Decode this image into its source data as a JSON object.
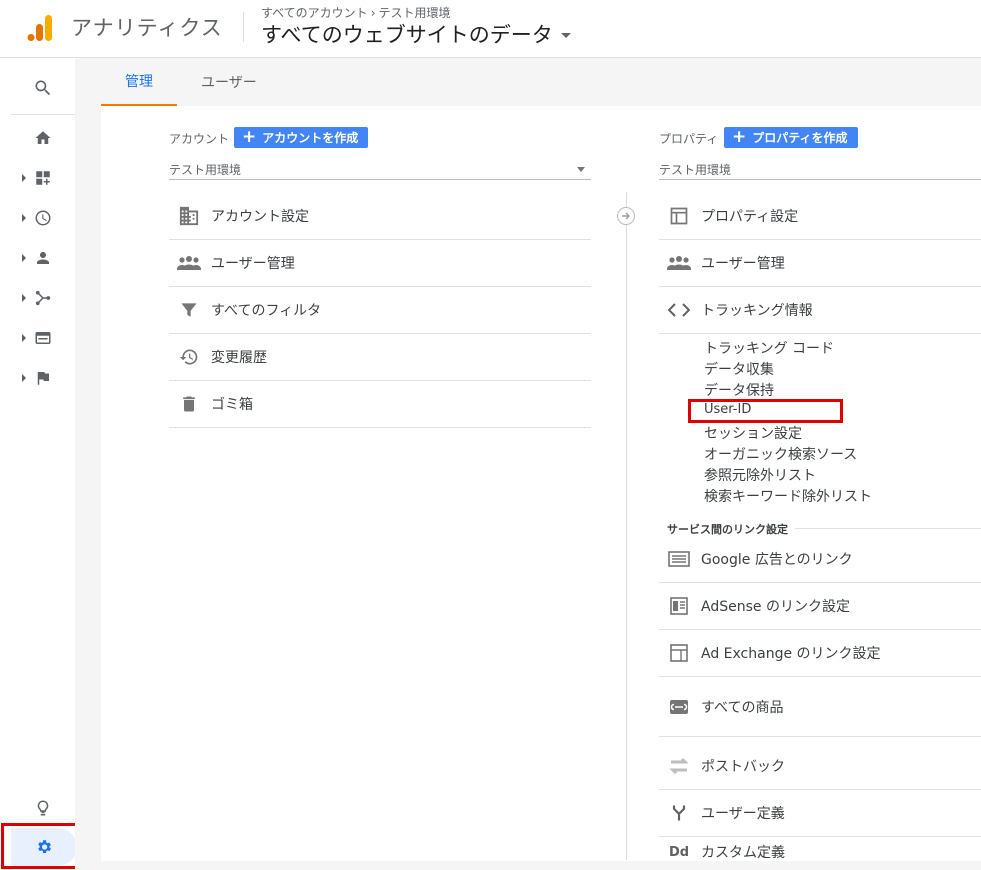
{
  "header": {
    "app_name": "アナリティクス",
    "breadcrumb_all": "すべてのアカウント",
    "breadcrumb_account": "テスト用環境",
    "view_name": "すべてのウェブサイトのデータ"
  },
  "rail": {
    "icons": [
      "search-icon",
      "home-icon",
      "customization-icon",
      "realtime-icon",
      "audience-icon",
      "acquisition-icon",
      "behavior-icon",
      "conversions-icon",
      "discover-icon",
      "admin-gear-icon"
    ]
  },
  "tabs": [
    {
      "label": "管理",
      "active": true
    },
    {
      "label": "ユーザー",
      "active": false
    }
  ],
  "account": {
    "label": "アカウント",
    "create_label": "アカウントを作成",
    "selected": "テスト用環境",
    "items": [
      {
        "label": "アカウント設定",
        "icon": "building-icon"
      },
      {
        "label": "ユーザー管理",
        "icon": "people-icon"
      },
      {
        "label": "すべてのフィルタ",
        "icon": "filter-icon"
      },
      {
        "label": "変更履歴",
        "icon": "history-icon"
      },
      {
        "label": "ゴミ箱",
        "icon": "trash-icon"
      }
    ]
  },
  "property": {
    "label": "プロパティ",
    "create_label": "プロパティを作成",
    "selected": "テスト用環境",
    "items": [
      {
        "label": "プロパティ設定",
        "icon": "property-icon"
      },
      {
        "label": "ユーザー管理",
        "icon": "people-icon"
      },
      {
        "label": "トラッキング情報",
        "icon": "code-icon"
      }
    ],
    "tracking_sublinks": [
      "トラッキング コード",
      "データ収集",
      "データ保持",
      "User-ID",
      "セッション設定",
      "オーガニック検索ソース",
      "参照元除外リスト",
      "検索キーワード除外リスト"
    ],
    "link_section_heading": "サービス間のリンク設定",
    "link_items": [
      {
        "label": "Google 広告とのリンク",
        "icon": "google-ads-icon"
      },
      {
        "label": "AdSense のリンク設定",
        "icon": "adsense-icon"
      },
      {
        "label": "Ad Exchange のリンク設定",
        "icon": "ad-exchange-icon"
      },
      {
        "label": "すべての商品",
        "icon": "link-icon"
      }
    ],
    "more_items": [
      {
        "label": "ポストバック",
        "icon": "postback-icon"
      },
      {
        "label": "ユーザー定義",
        "icon": "fork-icon"
      },
      {
        "label": "カスタム定義",
        "icon": "dd-icon"
      }
    ]
  },
  "colors": {
    "accent_blue": "#1a73e8",
    "button_blue": "#4285f4",
    "tab_underline": "#f57c00",
    "highlight_red": "#e00000",
    "logo_orange": "#f9ab00",
    "logo_dark_orange": "#e37400"
  }
}
